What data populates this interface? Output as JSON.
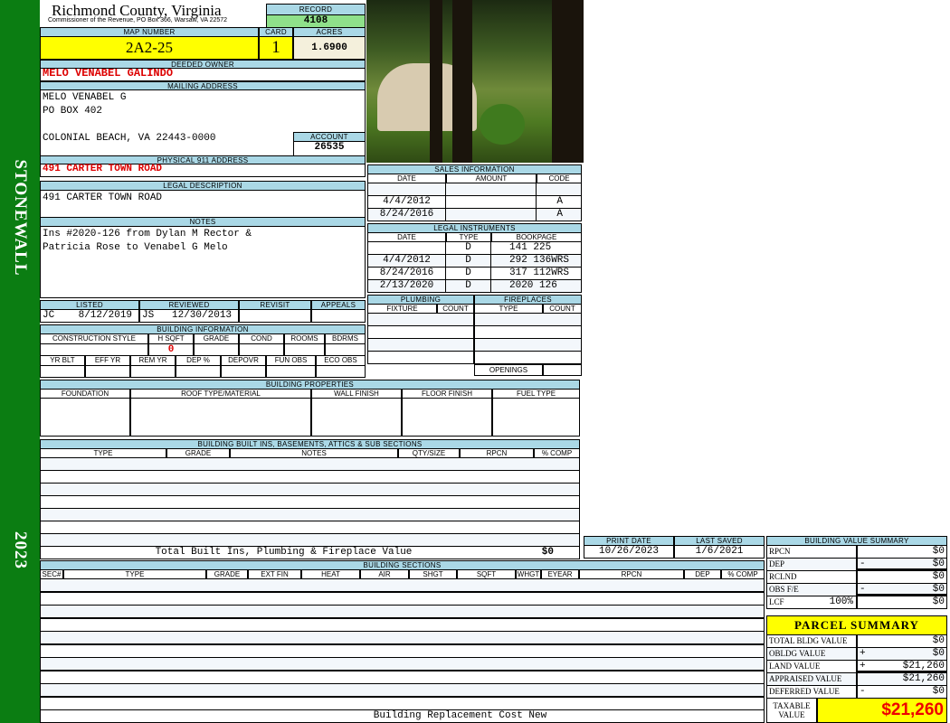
{
  "header": {
    "title": "Richmond County, Virginia",
    "subtitle": "Commissioner of the Revenue, PO Box 366, Warsaw, VA 22572"
  },
  "sidebar": {
    "district": "STONEWALL",
    "year": "2023"
  },
  "record": {
    "label": "RECORD",
    "value": "4108"
  },
  "map": {
    "map_label": "MAP NUMBER",
    "map_number": "2A2-25",
    "card_label": "CARD",
    "card": "1",
    "acres_label": "ACRES",
    "acres": "1.6900"
  },
  "owner": {
    "label": "DEEDED OWNER",
    "name": "MELO VENABEL GALINDO"
  },
  "mailing": {
    "label": "MAILING ADDRESS",
    "lines": [
      "MELO VENABEL G",
      "PO BOX 402",
      "",
      "COLONIAL BEACH, VA 22443-0000"
    ],
    "account_label": "ACCOUNT",
    "account": "26535"
  },
  "physical": {
    "label": "PHYSICAL 911 ADDRESS",
    "value": "491 CARTER TOWN ROAD"
  },
  "legal": {
    "label": "LEGAL DESCRIPTION",
    "value": "491 CARTER TOWN ROAD"
  },
  "notes": {
    "label": "NOTES",
    "lines": [
      "Ins #2020-126 from Dylan M Rector &",
      "Patricia Rose to Venabel G Melo"
    ]
  },
  "review": {
    "headers": [
      "LISTED",
      "REVIEWED",
      "REVISIT",
      "APPEALS"
    ],
    "listed": "JC    8/12/2019",
    "reviewed": "JS   12/30/2013"
  },
  "building_info": {
    "label": "BUILDING INFORMATION",
    "headers1": [
      "CONSTRUCTION STYLE",
      "H SQFT",
      "GRADE",
      "COND",
      "ROOMS",
      "BDRMS"
    ],
    "hsqft": "0",
    "headers2": [
      "YR BLT",
      "EFF YR",
      "REM YR",
      "DEP %",
      "DEPOVR",
      "FUN OBS",
      "ECO OBS"
    ]
  },
  "sales": {
    "label": "SALES INFORMATION",
    "headers": [
      "DATE",
      "AMOUNT",
      "CODE"
    ],
    "rows": [
      [
        "",
        "",
        ""
      ],
      [
        "4/4/2012",
        "",
        "A"
      ],
      [
        "8/24/2016",
        "",
        "A"
      ]
    ]
  },
  "instruments": {
    "label": "LEGAL INSTRUMENTS",
    "headers": [
      "DATE",
      "TYPE",
      "BOOKPAGE"
    ],
    "rows": [
      [
        "",
        "D",
        "141 225"
      ],
      [
        "4/4/2012",
        "D",
        "292 136WRS"
      ],
      [
        "8/24/2016",
        "D",
        "317 112WRS"
      ],
      [
        "2/13/2020",
        "D",
        "2020 126"
      ]
    ]
  },
  "plumbing": {
    "label": "PLUMBING",
    "headers": [
      "FIXTURE",
      "COUNT"
    ]
  },
  "fireplaces": {
    "label": "FIREPLACES",
    "headers": [
      "TYPE",
      "COUNT"
    ],
    "openings_label": "OPENINGS"
  },
  "properties": {
    "label": "BUILDING PROPERTIES",
    "headers": [
      "FOUNDATION",
      "ROOF TYPE/MATERIAL",
      "WALL FINISH",
      "FLOOR FINISH",
      "FUEL TYPE"
    ]
  },
  "builtins": {
    "label": "BUILDING BUILT INS, BASEMENTS, ATTICS & SUB SECTIONS",
    "headers": [
      "TYPE",
      "GRADE",
      "NOTES",
      "QTY/SIZE",
      "RPCN",
      "% COMP"
    ],
    "total_label": "Total Built Ins, Plumbing & Fireplace Value",
    "total": "$0"
  },
  "dates": {
    "print_label": "PRINT DATE",
    "print_date": "10/26/2023",
    "saved_label": "LAST SAVED",
    "last_saved": "1/6/2021"
  },
  "sections": {
    "label": "BUILDING SECTIONS",
    "headers": [
      "SEC#",
      "TYPE",
      "GRADE",
      "EXT FIN",
      "HEAT",
      "AIR",
      "SHGT",
      "SQFT",
      "WHGT",
      "EYEAR",
      "RPCN",
      "DEP",
      "% COMP"
    ],
    "footer": "Building Replacement Cost New"
  },
  "value_summary": {
    "label": "BUILDING VALUE SUMMARY",
    "rows": [
      {
        "label": "RPCN",
        "sign": "",
        "value": "$0"
      },
      {
        "label": "DEP",
        "sign": "-",
        "value": "$0"
      },
      {
        "label": "RCLND",
        "sign": "",
        "value": "$0"
      },
      {
        "label": "OBS F/E",
        "sign": "-",
        "value": "$0"
      },
      {
        "label": "LCF",
        "pct": "100%",
        "sign": "",
        "value": "$0"
      }
    ]
  },
  "parcel": {
    "label": "PARCEL SUMMARY",
    "rows": [
      {
        "label": "TOTAL BLDG VALUE",
        "sign": "",
        "value": "$0"
      },
      {
        "label": "OBLDG VALUE",
        "sign": "+",
        "value": "$0"
      },
      {
        "label": "LAND VALUE",
        "sign": "+",
        "value": "$21,260"
      },
      {
        "label": "APPRAISED VALUE",
        "sign": "",
        "value": "$21,260"
      },
      {
        "label": "DEFERRED VALUE",
        "sign": "-",
        "value": "$0"
      }
    ],
    "taxable_label": "TAXABLE VALUE",
    "taxable": "$21,260"
  }
}
